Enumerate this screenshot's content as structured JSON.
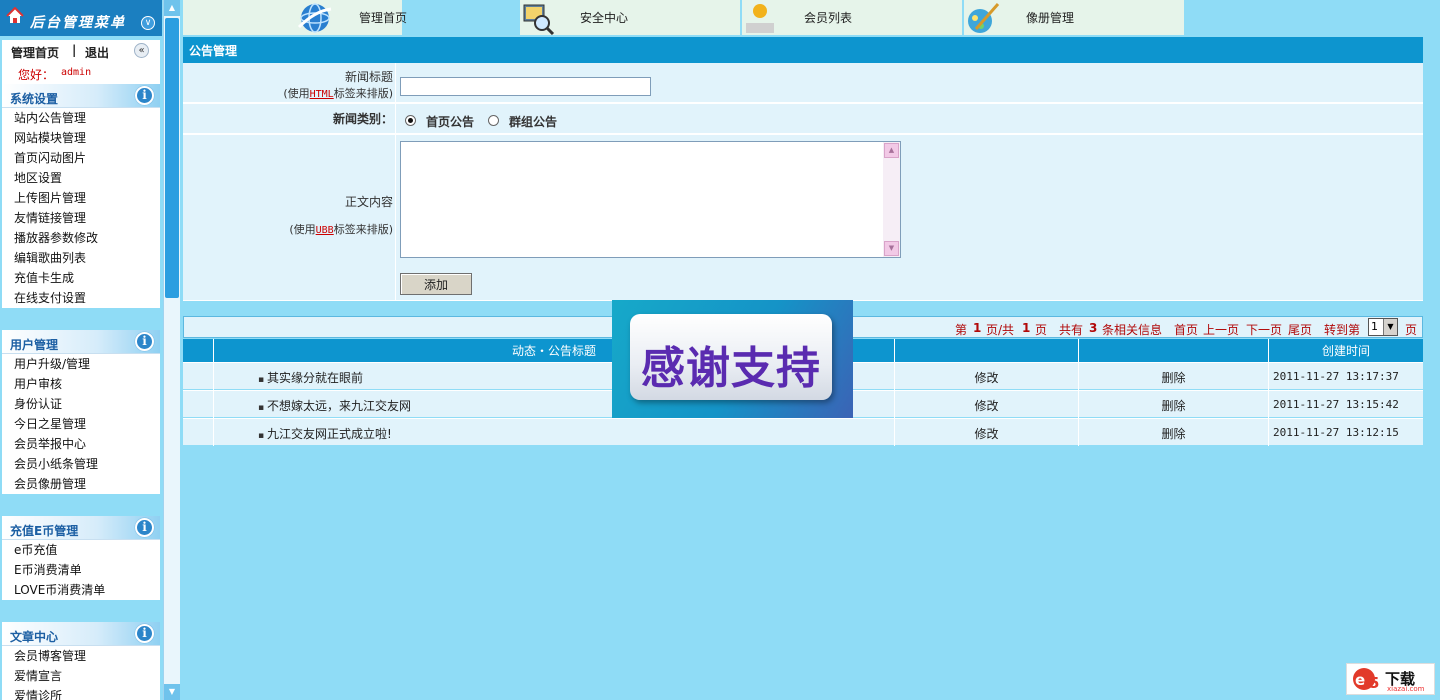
{
  "sidebar": {
    "title": "后台管理菜单",
    "nav": {
      "home": "管理首页",
      "separator": "|",
      "logout": "退出"
    },
    "greeting_label": "您好：",
    "username": "admin",
    "groups": [
      {
        "title": "系统设置",
        "items": [
          "站内公告管理",
          "网站模块管理",
          "首页闪动图片",
          "地区设置",
          "上传图片管理",
          "友情链接管理",
          "播放器参数修改",
          "编辑歌曲列表",
          "充值卡生成",
          "在线支付设置"
        ]
      },
      {
        "title": "用户管理",
        "items": [
          "用户升级/管理",
          "用户审核",
          "身份认证",
          "今日之星管理",
          "会员举报中心",
          "会员小纸条管理",
          "会员像册管理"
        ]
      },
      {
        "title": "充值E币管理",
        "items": [
          "e币充值",
          "E币消费清单",
          "LOVE币消费清单"
        ]
      },
      {
        "title": "文章中心",
        "items": [
          "会员博客管理",
          "爱情宣言",
          "爱情诊所"
        ]
      }
    ]
  },
  "topnav": {
    "tabs": [
      {
        "label": "管理首页",
        "icon": "globe-icon"
      },
      {
        "label": "安全中心",
        "icon": "security-scan-icon"
      },
      {
        "label": "会员列表",
        "icon": "members-icon"
      },
      {
        "label": "像册管理",
        "icon": "album-brush-icon"
      }
    ]
  },
  "panel": {
    "title": "公告管理",
    "news_title_label": "新闻标题",
    "news_title_hint_prefix": "(使用",
    "news_title_hint_tag": "HTML",
    "news_title_hint_suffix": "标签来排版)",
    "news_title_value": "",
    "category_label": "新闻类别：",
    "category_options": [
      "首页公告",
      "群组公告"
    ],
    "category_selected": "首页公告",
    "content_label": "正文内容",
    "content_hint_prefix": "(使用",
    "content_hint_tag": "UBB",
    "content_hint_suffix": "标签来排版)",
    "content_value": "",
    "add_button": "添加"
  },
  "pager": {
    "page_prefix": "第",
    "current_page": "1",
    "page_mid": "页/共",
    "total_pages": "1",
    "page_suffix": "页",
    "total_prefix": "共有",
    "total_count": "3",
    "total_suffix": "条相关信息",
    "first": "首页",
    "prev": "上一页",
    "next": "下一页",
    "last": "尾页",
    "goto_label": "转到第",
    "goto_value": "1",
    "goto_suffix": "页"
  },
  "list": {
    "headers": {
      "title": "动态・公告标题",
      "edit": "",
      "delete": "",
      "created": "创建时间"
    },
    "rows": [
      {
        "title": "其实缘分就在眼前",
        "edit": "修改",
        "delete": "删除",
        "created": "2011-11-27 13:17:37"
      },
      {
        "title": "不想嫁太远，来九江交友网",
        "edit": "修改",
        "delete": "删除",
        "created": "2011-11-27 13:15:42"
      },
      {
        "title": "九江交友网正式成立啦!",
        "edit": "修改",
        "delete": "删除",
        "created": "2011-11-27 13:12:15"
      }
    ]
  },
  "banner": {
    "text": "感谢支持"
  },
  "watermark": {
    "brand": "下载",
    "url": "xiazai.com"
  },
  "colors": {
    "accent": "#0d95cf",
    "background": "#8fdcf6",
    "row": "#e1f3fb",
    "pager_text": "#b10a0a"
  }
}
